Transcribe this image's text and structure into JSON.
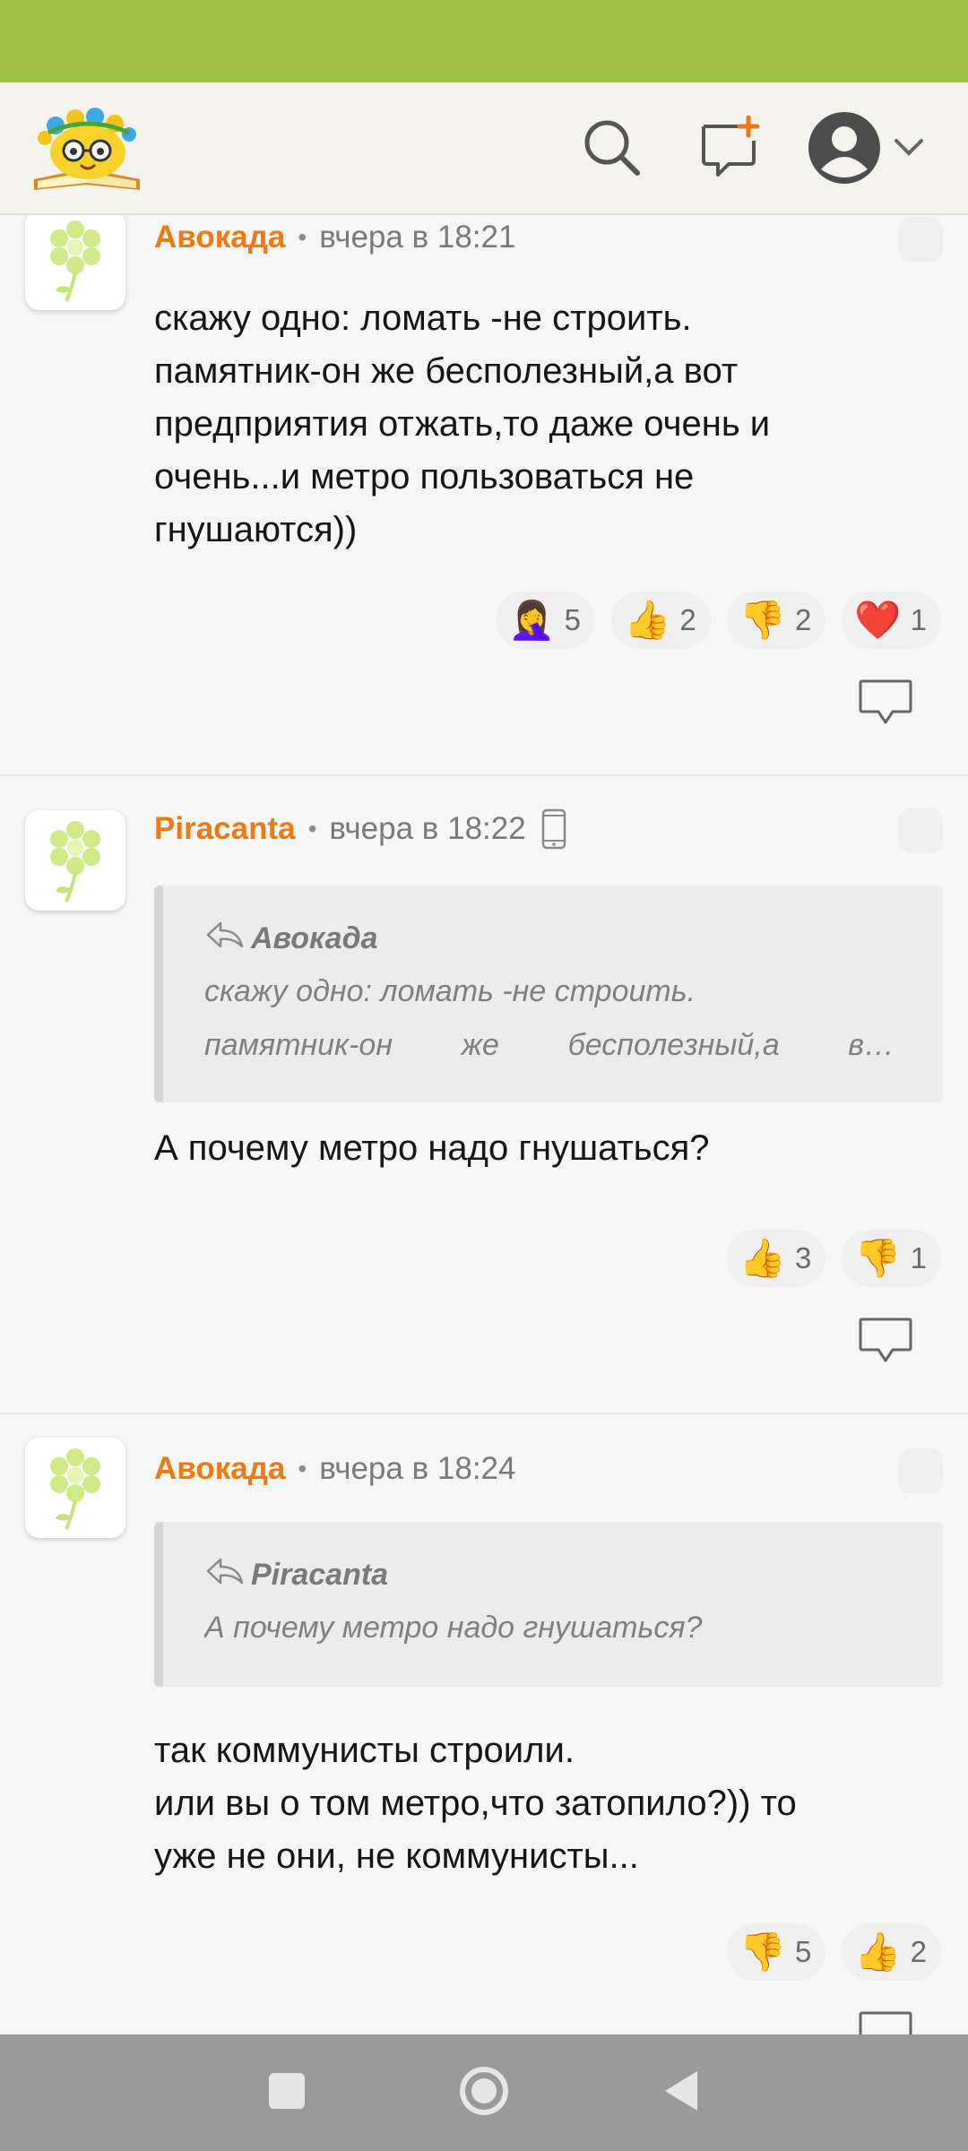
{
  "header": {
    "logo_name": "site-logo",
    "icons": [
      "search-icon",
      "new-post-icon",
      "user-avatar-icon",
      "chevron-down-icon"
    ]
  },
  "comments": [
    {
      "author": "Авокада",
      "time": "вчера в 18:21",
      "text": "скажу одно: ломать -не строить.\nпамятник-он же бесполезный,а вот\nпредприятия отжать,то даже очень и\nочень...и метро пользоваться не\nгнушаются))",
      "reactions": [
        {
          "emoji": "🤦‍♀️",
          "name": "facepalm",
          "count": "5"
        },
        {
          "emoji": "👍",
          "name": "thumbs-up",
          "count": "2"
        },
        {
          "emoji": "👎",
          "name": "thumbs-down",
          "count": "2"
        },
        {
          "emoji": "❤️",
          "name": "heart",
          "count": "1"
        }
      ]
    },
    {
      "author": "Piracanta",
      "time": "вчера в 18:22",
      "quote": {
        "author": "Авокада",
        "line1": "скажу одно: ломать -не строить.",
        "line2_words": [
          "памятник-он",
          "же",
          "бесполезный,а",
          "в…"
        ]
      },
      "text": "А почему метро надо гнушаться?",
      "reactions": [
        {
          "emoji": "👍",
          "name": "thumbs-up",
          "count": "3"
        },
        {
          "emoji": "👎",
          "name": "thumbs-down",
          "count": "1"
        }
      ]
    },
    {
      "author": "Авокада",
      "time": "вчера в 18:24",
      "quote": {
        "author": "Piracanta",
        "line1": "А почему метро надо гнушаться?"
      },
      "text": "так коммунисты строили.\nили вы о том метро,что затопило?)) то\nуже не они, не коммунисты...",
      "reactions": [
        {
          "emoji": "👎",
          "name": "thumbs-down",
          "count": "5"
        },
        {
          "emoji": "👍",
          "name": "thumbs-up",
          "count": "2"
        }
      ]
    }
  ],
  "nav": {
    "buttons": [
      "recents-button",
      "home-button",
      "back-button"
    ]
  }
}
